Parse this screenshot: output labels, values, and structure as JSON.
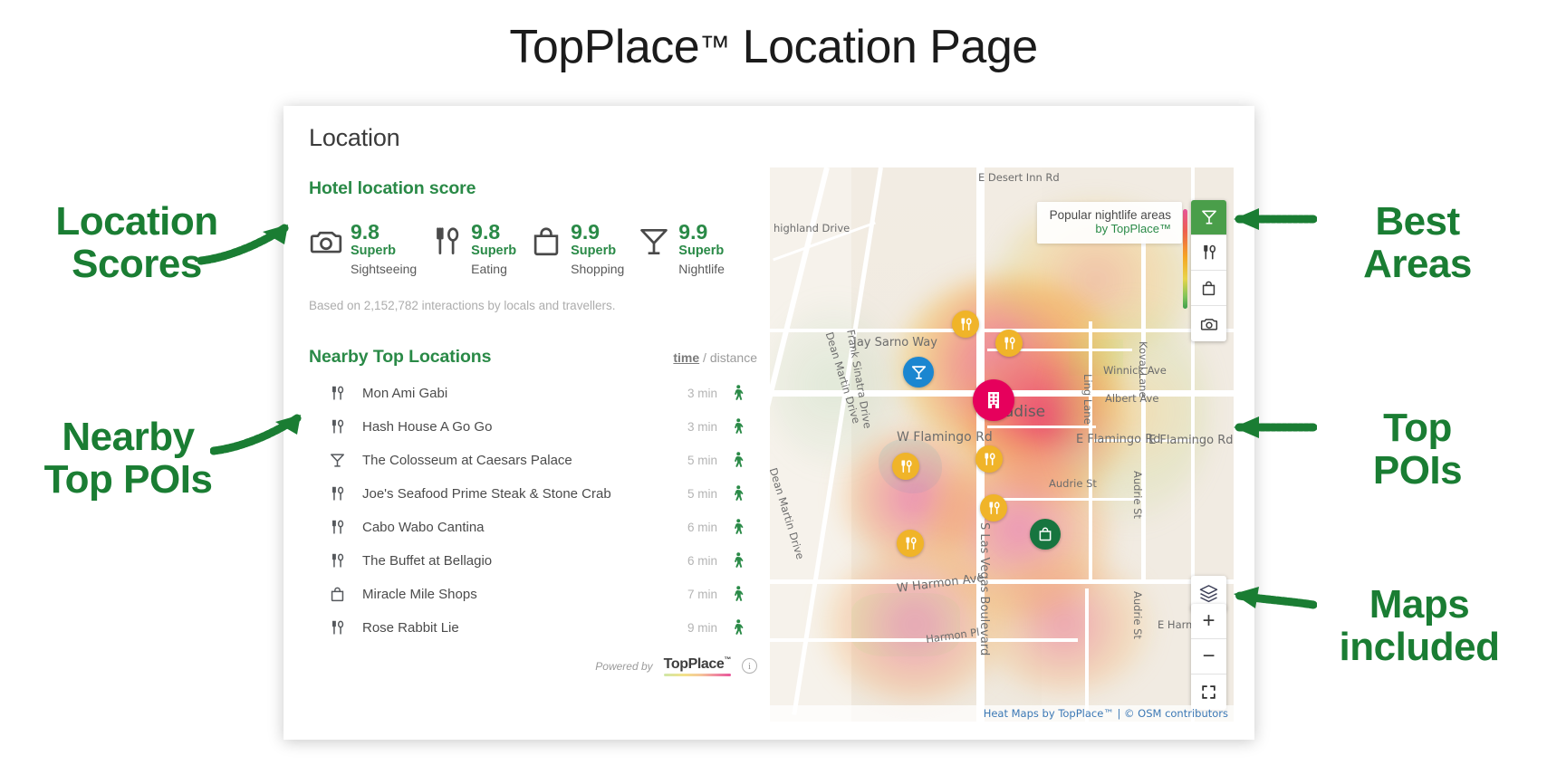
{
  "page": {
    "title_main": "TopPlace",
    "title_tm": "™",
    "title_rest": " Location Page"
  },
  "card": {
    "title": "Location"
  },
  "scores_section": {
    "heading": "Hotel location score",
    "basis": "Based on 2,152,782 interactions by locals and travellers.",
    "items": [
      {
        "icon": "camera-icon",
        "value": "9.8",
        "word": "Superb",
        "category": "Sightseeing"
      },
      {
        "icon": "cutlery-icon",
        "value": "9.8",
        "word": "Superb",
        "category": "Eating"
      },
      {
        "icon": "shopping-bag-icon",
        "value": "9.9",
        "word": "Superb",
        "category": "Shopping"
      },
      {
        "icon": "cocktail-icon",
        "value": "9.9",
        "word": "Superb",
        "category": "Nightlife"
      }
    ]
  },
  "nearby": {
    "heading": "Nearby Top Locations",
    "sort_active": "time",
    "sort_sep": " / ",
    "sort_other": "distance",
    "items": [
      {
        "icon": "cutlery-icon",
        "name": "Mon Ami Gabi",
        "time": "3 min",
        "mode": "walking-icon"
      },
      {
        "icon": "cutlery-icon",
        "name": "Hash House A Go Go",
        "time": "3 min",
        "mode": "walking-icon"
      },
      {
        "icon": "cocktail-icon",
        "name": "The Colosseum at Caesars Palace",
        "time": "5 min",
        "mode": "walking-icon"
      },
      {
        "icon": "cutlery-icon",
        "name": "Joe's Seafood Prime Steak & Stone Crab",
        "time": "5 min",
        "mode": "walking-icon"
      },
      {
        "icon": "cutlery-icon",
        "name": "Cabo Wabo Cantina",
        "time": "6 min",
        "mode": "walking-icon"
      },
      {
        "icon": "cutlery-icon",
        "name": "The Buffet at Bellagio",
        "time": "6 min",
        "mode": "walking-icon"
      },
      {
        "icon": "shopping-bag-icon",
        "name": "Miracle Mile Shops",
        "time": "7 min",
        "mode": "walking-icon"
      },
      {
        "icon": "cutlery-icon",
        "name": "Rose Rabbit Lie",
        "time": "9 min",
        "mode": "walking-icon"
      }
    ]
  },
  "footer": {
    "powered_by": "Powered by",
    "brand": "TopPlace",
    "brand_tm": "™",
    "info_glyph": "i"
  },
  "map": {
    "popup_line1": "Popular nightlife areas",
    "popup_line2": "by TopPlace™",
    "categories": [
      {
        "icon": "cocktail-icon",
        "name": "nightlife",
        "active": true
      },
      {
        "icon": "cutlery-icon",
        "name": "eating",
        "active": false
      },
      {
        "icon": "shopping-bag-icon",
        "name": "shopping",
        "active": false
      },
      {
        "icon": "camera-icon",
        "name": "sightseeing",
        "active": false
      }
    ],
    "controls": {
      "layers": "layers-icon",
      "zoom_in": "+",
      "zoom_out": "−",
      "fullscreen": "fullscreen-icon"
    },
    "attribution": "Heat Maps by TopPlace™ | © OSM contributors",
    "road_labels": [
      "Dean Martin Drive",
      "Dean Martin Drive",
      "Frank Sinatra Drive",
      "Jay Sarno Way",
      "W Flamingo Rd",
      "E Flamingo Rd",
      "E Flamingo Rd",
      "Koval Lane",
      "Ling Lane",
      "Winnick Ave",
      "Albert Ave",
      "Audrie St",
      "Audrie St",
      "Audrie St",
      "S Las Vegas Boulevard",
      "W Harmon Ave",
      "Harmon Pl",
      "E Harmon",
      "highland Drive",
      "E Desert Inn Rd"
    ],
    "place_label": "Paradise"
  },
  "annotations": [
    {
      "line1": "Location",
      "line2": "Scores",
      "side": "left"
    },
    {
      "line1": "Nearby",
      "line2": "Top POIs",
      "side": "left"
    },
    {
      "line1": "Best",
      "line2": "Areas",
      "side": "right"
    },
    {
      "line1": "Top",
      "line2": "POIs",
      "side": "right"
    },
    {
      "line1": "Maps",
      "line2": "included",
      "side": "right"
    }
  ],
  "colors": {
    "brand_green": "#2a8a47",
    "anno_green": "#1a7d33",
    "hotel_pin": "#e6005c",
    "food_pin": "#f0b429",
    "night_pin": "#1b86d0",
    "shop_pin": "#17753f"
  }
}
